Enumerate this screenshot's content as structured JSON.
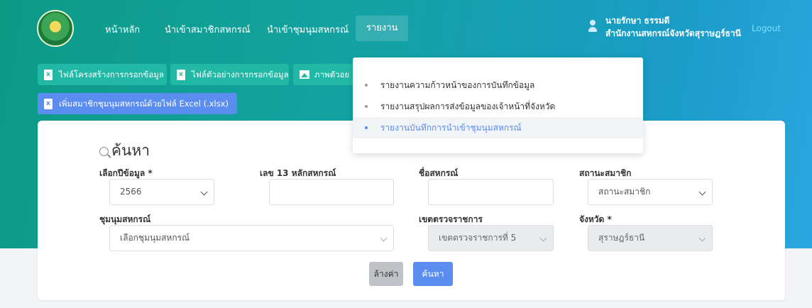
{
  "nav": {
    "home": "หน้าหลัก",
    "import_members": "นำเข้าสมาชิกสหกรณ์",
    "import_federation": "นำเข้าชุมนุมสหกรณ์",
    "reports": "รายงาน"
  },
  "user": {
    "name": "นายรักษา ธรรมดี",
    "org": "สำนักงานสหกรณ์จังหวัดสุราษฎร์ธานี",
    "logout": "Logout"
  },
  "toolbar": {
    "structure_file": "ไฟล์โครงสร้างการกรอกข้อมูล",
    "sample_file": "ไฟล์ตัวอย่างการกรอกข้อมูล",
    "sample_image": "ภาพตัวอย",
    "add_excel": "เพิ่มสมาชิกชุมนุมสหกรณ์ด้วยไฟล์ Excel (.xlsx)"
  },
  "reports_menu": {
    "items": [
      "รายงานความก้าวหน้าของการบันทึกข้อมูล",
      "รายงานสรุปผลการส่งข้อมูลของเจ้าหน้าที่จังหวัด",
      "รายงานบันทึกการนำเข้าชุมนุมสหกรณ์"
    ]
  },
  "search": {
    "title": "ค้นหา",
    "year_label": "เลือกปีข้อมูล *",
    "year_value": "2566",
    "coop_id_label": "เลข 13 หลักสหกรณ์",
    "coop_id_value": "",
    "coop_name_label": "ชื่อสหกรณ์",
    "coop_name_value": "",
    "member_status_label": "สถานะสมาชิก",
    "member_status_value": "สถานะสมาชิก",
    "federation_label": "ชุมนุมสหกรณ์",
    "federation_value": "เลือกชุมนุมสหกรณ์",
    "inspection_label": "เขตตรวจราชการ",
    "inspection_value": "เขตตรวจราชการที่ 5",
    "province_label": "จังหวัด *",
    "province_value": "สุราษฎร์ธานี",
    "clear_button": "ล้างค่า",
    "search_button": "ค้นหา"
  },
  "colors": {
    "teal": "#22b8a6",
    "blue": "#5b8cf0",
    "gradient_start": "#0c9a86",
    "gradient_end": "#2aa7e0"
  }
}
